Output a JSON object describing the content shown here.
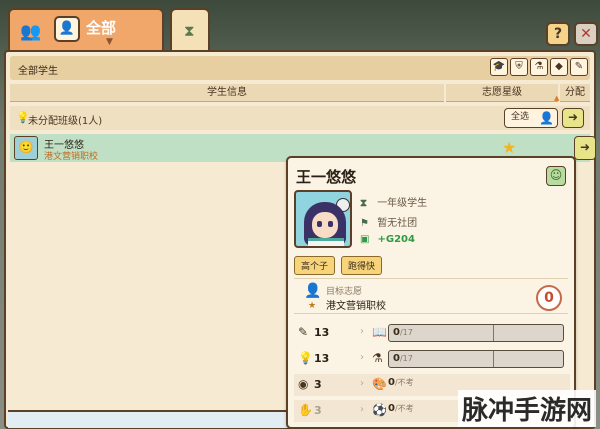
{
  "tabs": {
    "all_label": "全部",
    "hour_icon": "hourglass-icon"
  },
  "header_buttons": {
    "help": "?",
    "close": "✕"
  },
  "toolbar": {
    "title": "全部学生",
    "filters": [
      "hat-icon",
      "shield-icon",
      "flask-icon",
      "diamond-icon",
      "edit-icon"
    ]
  },
  "columns": {
    "info": "学生信息",
    "wish": "志愿星级",
    "assign": "分配"
  },
  "group": {
    "label": "未分配班级(1人)",
    "select_all": "全选"
  },
  "student": {
    "name": "王一悠悠",
    "school": "港文营销职校"
  },
  "detail": {
    "name": "王一悠悠",
    "grade": "一年级学生",
    "club": "暂无社团",
    "money": "+G204",
    "tags": [
      "高个子",
      "跑得快"
    ],
    "target_label": "目标志愿",
    "target_school": "港文营销职校",
    "target_count": "0",
    "stats": [
      {
        "icon": "book-icon",
        "value": "13",
        "bar_value": "0",
        "bar_max": "/17",
        "fill": 0.0
      },
      {
        "icon": "bulb-icon",
        "value": "13",
        "bar_value": "0",
        "bar_max": "/17",
        "fill": 0.0
      },
      {
        "icon": "eye-icon",
        "value": "3",
        "bar_value": "0",
        "bar_max": "/不考"
      },
      {
        "icon": "hand-icon",
        "value": "3",
        "bar_value": "0",
        "bar_max": "/不考"
      }
    ]
  },
  "watermark": "脉冲手游网"
}
